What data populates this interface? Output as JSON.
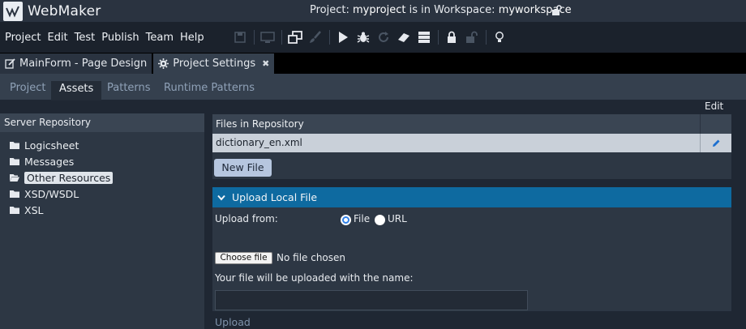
{
  "app": {
    "name": "WebMaker",
    "project_prefix": "Project: ",
    "project_name": "myproject",
    "workspace_prefix": " is in Workspace: ",
    "workspace_name": "myworkspace"
  },
  "menu": [
    "Project",
    "Edit",
    "Test",
    "Publish",
    "Team",
    "Help"
  ],
  "toolbar_icons": [
    "save-icon",
    "monitor-icon",
    "window-stack-icon",
    "brush-icon",
    "play-icon",
    "bug-icon",
    "refresh-icon",
    "eraser-icon",
    "server-icon",
    "lock-icon",
    "unlock-icon",
    "lightbulb-icon"
  ],
  "tabs": [
    {
      "label": "MainForm - Page Design",
      "icon": "edit-icon"
    },
    {
      "label": "Project Settings",
      "icon": "gear-icon",
      "close": "✖"
    }
  ],
  "subtabs": [
    "Project",
    "Assets",
    "Patterns",
    "Runtime Patterns"
  ],
  "edit_label": "Edit",
  "server_repository": {
    "title": "Server Repository",
    "items": [
      "Logicsheet",
      "Messages",
      "Other Resources",
      "XSD/WSDL",
      "XSL"
    ],
    "selected": "Other Resources"
  },
  "files": {
    "header": "Files in Repository",
    "rows": [
      "dictionary_en.xml"
    ],
    "new_file_label": "New File"
  },
  "upload": {
    "title": "Upload Local File",
    "upload_from_label": "Upload from:",
    "option_file": "File",
    "option_url": "URL",
    "selected_option": "File",
    "choose_file_label": "Choose file",
    "no_file_text": "No file chosen",
    "name_label": "Your file will be uploaded with the name:",
    "name_value": "",
    "upload_label": "Upload"
  },
  "colors": {
    "accent": "#0e6aa0",
    "selected_row": "#c9d0d9",
    "button": "#b6c6df"
  }
}
